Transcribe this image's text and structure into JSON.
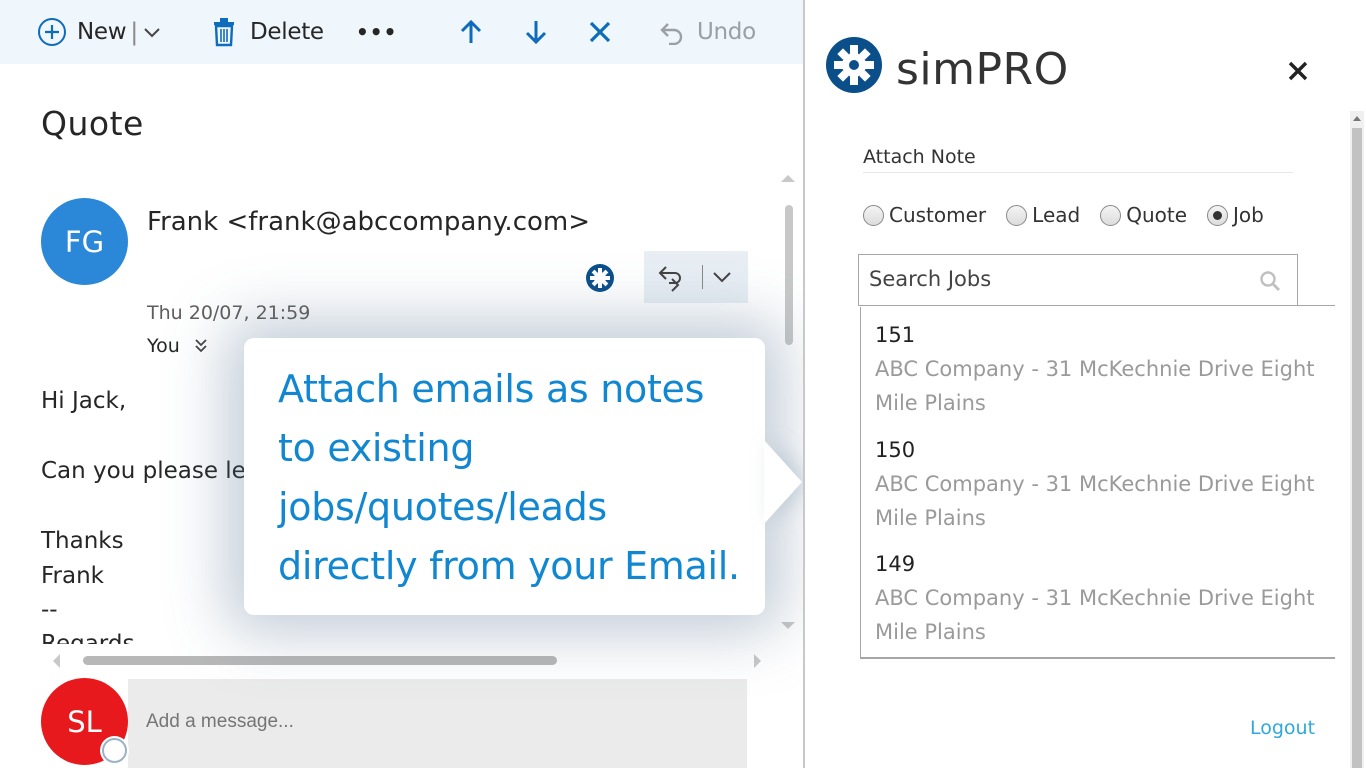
{
  "toolbar": {
    "new_label": "New",
    "delete_label": "Delete",
    "more_label": "•••",
    "undo_label": "Undo"
  },
  "email": {
    "subject": "Quote",
    "sender_initials": "FG",
    "sender": "Frank <frank@abccompany.com>",
    "date": "Thu 20/07, 21:59",
    "recipient": "You",
    "body": [
      "Hi Jack,",
      "Can you please le",
      "Thanks",
      "Frank",
      "--",
      "Regards"
    ]
  },
  "compose": {
    "user_initials": "SL",
    "placeholder": "Add a message..."
  },
  "callout": {
    "lines": [
      "Attach emails as notes",
      "to existing",
      "jobs/quotes/leads",
      "directly from your Email."
    ]
  },
  "addin": {
    "brand": "simPRO",
    "section_label": "Attach Note",
    "radio_options": [
      {
        "label": "Customer",
        "checked": false
      },
      {
        "label": "Lead",
        "checked": false
      },
      {
        "label": "Quote",
        "checked": false
      },
      {
        "label": "Job",
        "checked": true
      }
    ],
    "search_placeholder": "Search Jobs",
    "results": [
      {
        "number": "151",
        "description": "ABC Company - 31 McKechnie Drive Eight Mile Plains"
      },
      {
        "number": "150",
        "description": "ABC Company - 31 McKechnie Drive Eight Mile Plains"
      },
      {
        "number": "149",
        "description": "ABC Company - 31 McKechnie Drive Eight Mile Plains"
      }
    ],
    "logout_label": "Logout"
  },
  "colors": {
    "accent": "#0f6cbd",
    "callout_text": "#1187d1",
    "avatar_fg": "#2b88d8",
    "avatar_sl": "#e8191c",
    "logout_link": "#2fa8df",
    "toolbar_bg": "#eff6fc"
  }
}
